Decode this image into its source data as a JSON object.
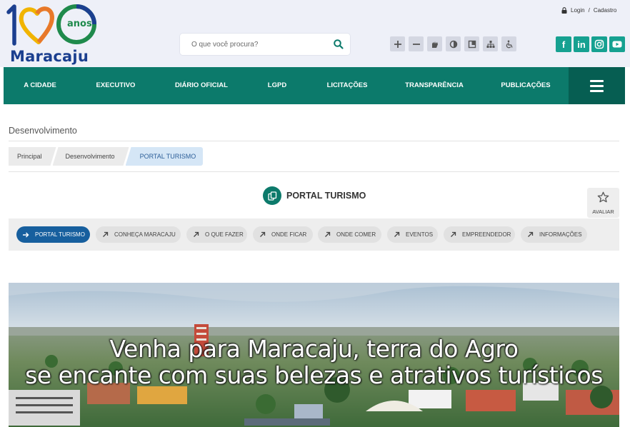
{
  "header": {
    "logo": {
      "number": "100",
      "anos": "anos",
      "city": "Maracaju"
    },
    "search": {
      "placeholder": "O que você procura?"
    },
    "accessibility": [
      {
        "icon": "zoom-in-icon"
      },
      {
        "icon": "zoom-out-icon"
      },
      {
        "icon": "sign-language-icon"
      },
      {
        "icon": "contrast-icon"
      },
      {
        "icon": "shortcuts-icon"
      },
      {
        "icon": "sitemap-icon"
      },
      {
        "icon": "wheelchair-icon"
      }
    ],
    "social": [
      {
        "label": "f",
        "icon": "facebook-icon"
      },
      {
        "label": "in",
        "icon": "linkedin-icon"
      },
      {
        "label": "",
        "icon": "instagram-icon"
      },
      {
        "label": "",
        "icon": "youtube-icon"
      }
    ],
    "login": "Login",
    "separator": "/",
    "register": "Cadastro"
  },
  "nav": {
    "items": [
      "A CIDADE",
      "EXECUTIVO",
      "DIÁRIO OFICIAL",
      "LGPD",
      "LICITAÇÕES",
      "TRANSPARÊNCIA",
      "PUBLICAÇÕES"
    ]
  },
  "breadcrumb": {
    "section": "Desenvolvimento",
    "items": [
      "Principal",
      "Desenvolvimento",
      "PORTAL TURISMO"
    ]
  },
  "page": {
    "title": "PORTAL TURISMO",
    "rate_label": "AVALIAR"
  },
  "subnav": {
    "items": [
      {
        "label": "PORTAL TURISMO",
        "active": true
      },
      {
        "label": "CONHEÇA MARACAJU",
        "active": false
      },
      {
        "label": "O QUE FAZER",
        "active": false
      },
      {
        "label": "ONDE FICAR",
        "active": false
      },
      {
        "label": "ONDE COMER",
        "active": false
      },
      {
        "label": "EVENTOS",
        "active": false
      },
      {
        "label": "EMPREENDEDOR",
        "active": false
      },
      {
        "label": "INFORMAÇÕES",
        "active": false
      }
    ]
  },
  "hero": {
    "line1": "Venha para Maracaju, terra do Agro",
    "line2": "se encante com suas belezas e atrativos turísticos"
  },
  "colors": {
    "nav_bg": "#0c7a6b",
    "nav_menu_bg": "#065e52",
    "social_bg": "#16a191",
    "brand_blue": "#1b3f8f",
    "active_chip": "#175f9e",
    "crumb_active": "#d5e6f6"
  }
}
